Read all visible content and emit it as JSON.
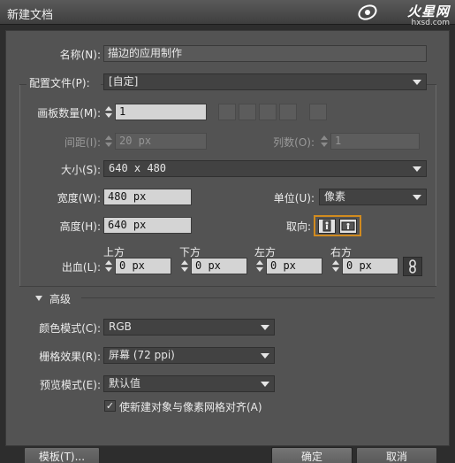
{
  "window": {
    "title": "新建文档"
  },
  "watermark": {
    "brand": "火星网",
    "url": "hxsd.com"
  },
  "form": {
    "name": {
      "label": "名称(N):",
      "value": "描边的应用制作"
    },
    "profile": {
      "label": "配置文件(P):",
      "value": "[自定]"
    },
    "artboards": {
      "label": "画板数量(M):",
      "value": "1"
    },
    "spacing": {
      "label": "间距(I):",
      "value": "20 px"
    },
    "columns": {
      "label": "列数(O):",
      "value": "1"
    },
    "size": {
      "label": "大小(S):",
      "value": "640 x 480"
    },
    "width": {
      "label": "宽度(W):",
      "value": "480 px"
    },
    "units": {
      "label": "单位(U):",
      "value": "像素"
    },
    "height": {
      "label": "高度(H):",
      "value": "640 px"
    },
    "orientation": {
      "label": "取向:"
    },
    "bleed": {
      "label": "出血(L):",
      "top": {
        "label": "上方",
        "value": "0 px"
      },
      "bottom": {
        "label": "下方",
        "value": "0 px"
      },
      "left": {
        "label": "左方",
        "value": "0 px"
      },
      "right": {
        "label": "右方",
        "value": "0 px"
      }
    }
  },
  "advanced": {
    "header": "高级",
    "color_mode": {
      "label": "颜色模式(C):",
      "value": "RGB"
    },
    "raster_effects": {
      "label": "栅格效果(R):",
      "value": "屏幕 (72 ppi)"
    },
    "preview_mode": {
      "label": "预览模式(E):",
      "value": "默认值"
    },
    "align_pixel": {
      "label": "使新建对象与像素网格对齐(A)",
      "checked": true
    }
  },
  "buttons": {
    "templates": "模板(T)...",
    "ok": "确定",
    "cancel": "取消"
  },
  "colors": {
    "accent": "#d18b1f",
    "panel": "#535353",
    "titlebar": "#4a4a4a"
  }
}
